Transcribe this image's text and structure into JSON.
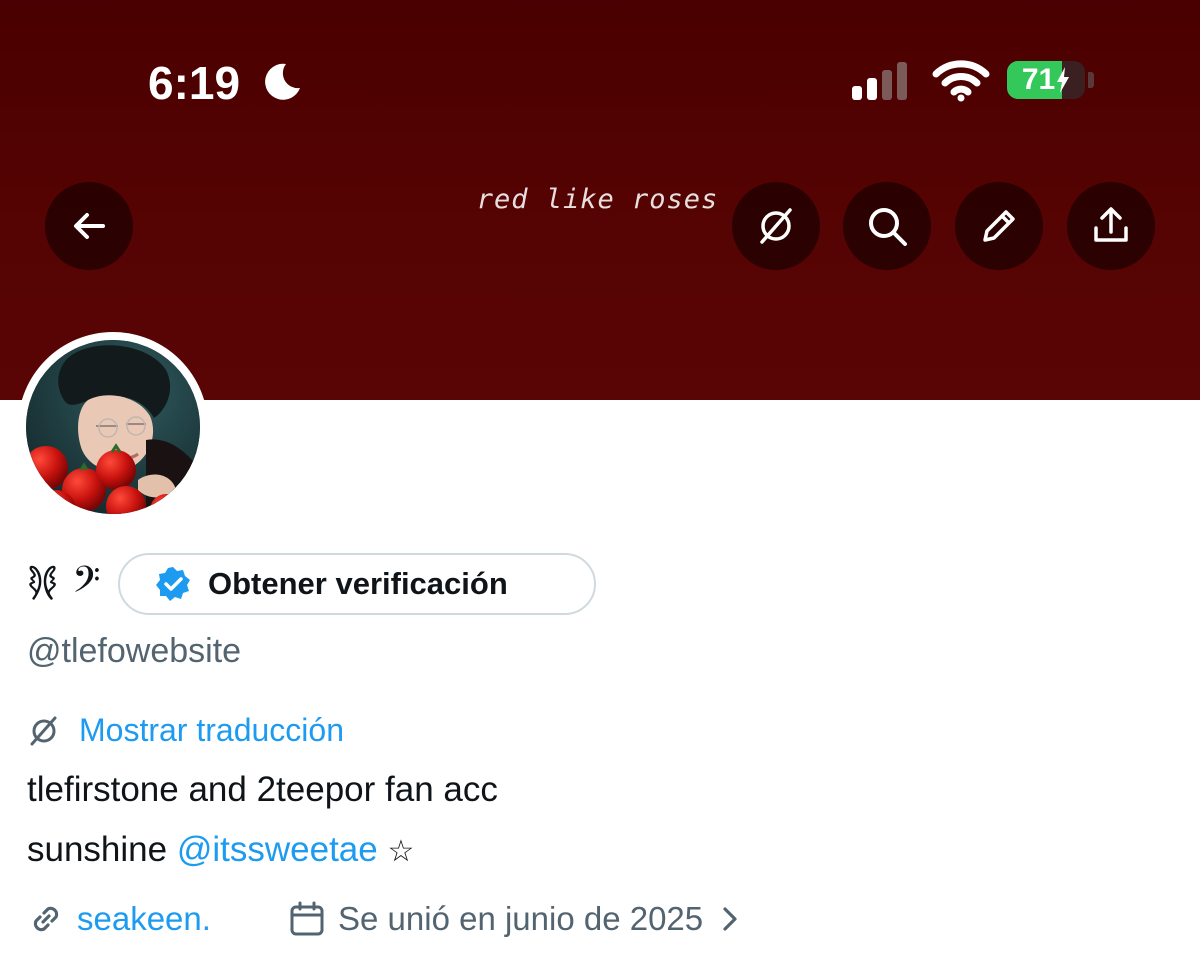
{
  "status_bar": {
    "time": "6:19",
    "battery_percent": "71",
    "battery_level": 0.71,
    "icons": [
      "moon-icon",
      "cellular-signal-icon",
      "wifi-icon",
      "battery-charging-icon"
    ]
  },
  "header": {
    "banner_text": "red like roses",
    "buttons": [
      "back-arrow-icon",
      "translate-icon",
      "search-icon",
      "edit-icon",
      "share-icon"
    ],
    "colors": {
      "banner": "#560303",
      "button_bg": "#1a0000"
    }
  },
  "profile": {
    "name_glyph": "𐦍 𝄢",
    "verify_label": "Obtener verificación",
    "handle": "@tlefowebsite",
    "translate_label": "Mostrar traducción",
    "bio_line1": "tlefirstone and 2teepor fan acc",
    "bio_line2_prefix": "sunshine",
    "bio_mention": "@itssweetae",
    "bio_star": "☆",
    "link_text": "seakeen.",
    "joined_text": "Se unió en junio de 2025"
  },
  "colors": {
    "accent": "#1d9bf0",
    "secondary_text": "#536471",
    "verified_badge": "#1d9bf0"
  }
}
